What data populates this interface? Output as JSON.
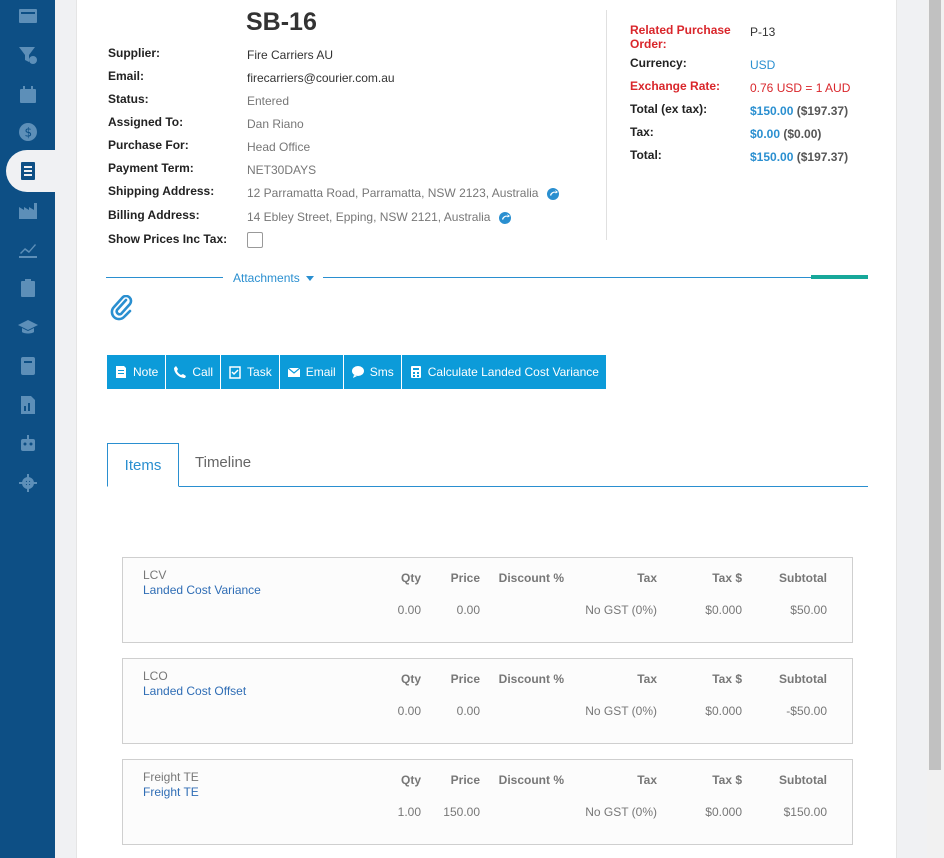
{
  "sidebar": {
    "icons": [
      "dashboard-icon",
      "funnel-icon",
      "calendar-icon",
      "dollar-icon",
      "checklist-icon",
      "factory-icon",
      "trend-icon",
      "clipboard-icon",
      "graduation-cap-icon",
      "book-icon",
      "report-icon",
      "robot-icon",
      "gear-icon"
    ]
  },
  "header": {
    "title": "SB-16"
  },
  "details": {
    "supplier_label": "Supplier:",
    "supplier": "Fire Carriers AU",
    "email_label": "Email:",
    "email": "firecarriers@courier.com.au",
    "status_label": "Status:",
    "status": "Entered",
    "assigned_label": "Assigned To:",
    "assigned": "Dan Riano",
    "purchase_for_label": "Purchase For:",
    "purchase_for": "Head Office",
    "payment_term_label": "Payment Term:",
    "payment_term": "NET30DAYS",
    "shipping_label": "Shipping Address:",
    "shipping": "12 Parramatta Road, Parramatta, NSW 2123, Australia",
    "billing_label": "Billing Address:",
    "billing": "14 Ebley Street, Epping, NSW 2121, Australia",
    "show_prices_label": "Show Prices Inc Tax:"
  },
  "summary": {
    "related_po_label_1": "Related Purchase",
    "related_po_label_2": "Order:",
    "related_po": "P-13",
    "currency_label": "Currency:",
    "currency": "USD",
    "exchange_label": "Exchange Rate:",
    "exchange": "0.76 USD = 1 AUD",
    "total_ex_label": "Total (ex tax):",
    "total_ex": "$150.00",
    "total_ex_aud": "($197.37)",
    "tax_label": "Tax:",
    "tax": "$0.00",
    "tax_aud": "($0.00)",
    "total_label": "Total:",
    "total": "$150.00",
    "total_aud": "($197.37)"
  },
  "attachments": {
    "label": "Attachments"
  },
  "toolbar": {
    "note": "Note",
    "call": "Call",
    "task": "Task",
    "email": "Email",
    "sms": "Sms",
    "landed": "Calculate Landed Cost Variance"
  },
  "tabs": {
    "items": "Items",
    "timeline": "Timeline"
  },
  "columns": {
    "qty": "Qty",
    "price": "Price",
    "discount": "Discount %",
    "tax": "Tax",
    "tax_amount": "Tax $",
    "subtotal": "Subtotal"
  },
  "items": [
    {
      "code": "LCV",
      "name": "Landed Cost Variance",
      "qty": "0.00",
      "price": "0.00",
      "discount": "",
      "tax": "No GST (0%)",
      "tax_amount": "$0.000",
      "subtotal": "$50.00"
    },
    {
      "code": "LCO",
      "name": "Landed Cost Offset",
      "qty": "0.00",
      "price": "0.00",
      "discount": "",
      "tax": "No GST (0%)",
      "tax_amount": "$0.000",
      "subtotal": "-$50.00"
    },
    {
      "code": "Freight TE",
      "name": "Freight TE",
      "qty": "1.00",
      "price": "150.00",
      "discount": "",
      "tax": "No GST (0%)",
      "tax_amount": "$0.000",
      "subtotal": "$150.00"
    }
  ]
}
